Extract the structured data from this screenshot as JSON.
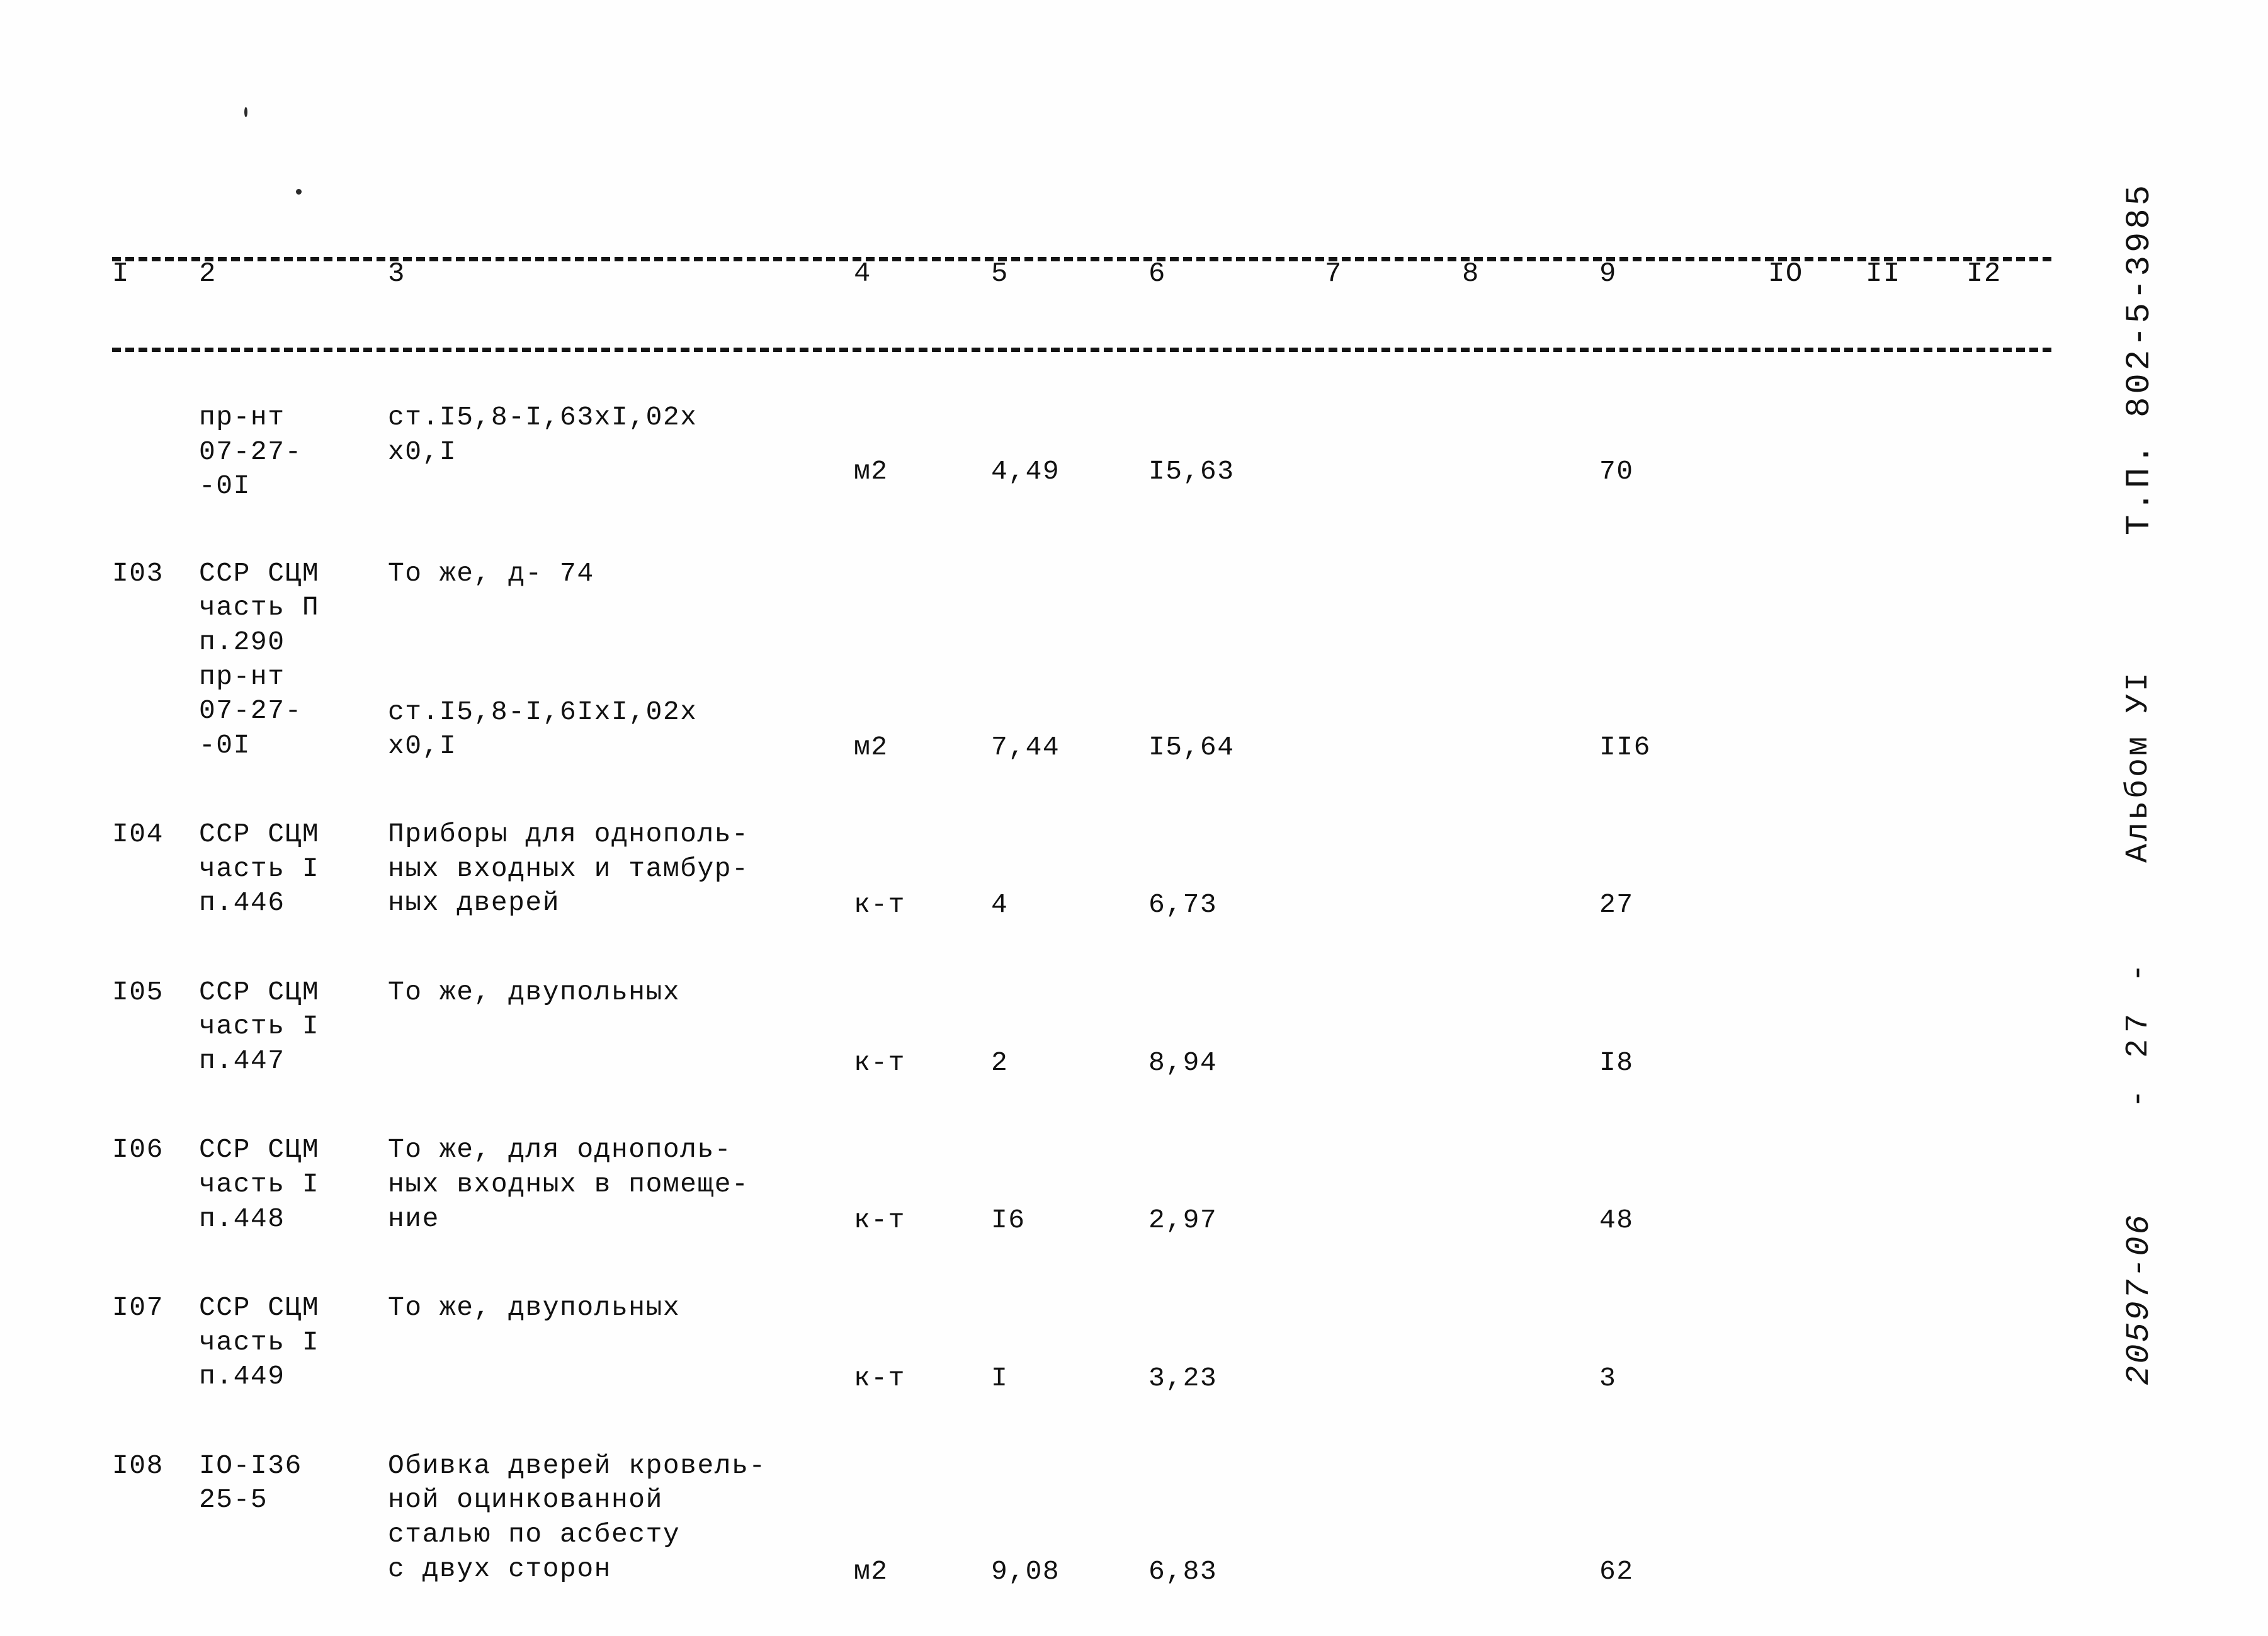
{
  "document": {
    "type": "estimate-table-sheet",
    "column_numbers": [
      "I",
      "2",
      "3",
      "4",
      "5",
      "6",
      "7",
      "8",
      "9",
      "IO",
      "II",
      "I2"
    ]
  },
  "margin": {
    "project_code": "Т.П. 802-5-3985",
    "album": "Альбом УI",
    "page": "- 27 -",
    "archive_code": "20597-06"
  },
  "rows": [
    {
      "num": "",
      "source": "пр-нт\n07-27-\n-0I",
      "description": "ст.I5,8-I,63xI,02x\nх0,I",
      "unit": "м2",
      "qty": "4,49",
      "price": "I5,63",
      "c7": "",
      "c8": "",
      "total": "70",
      "c10": "",
      "c11": "",
      "c12": ""
    },
    {
      "num": "I03",
      "source": "ССР СЦМ\nчасть П\nп.290",
      "description": "То же, д- 74",
      "unit": "",
      "qty": "",
      "price": "",
      "c7": "",
      "c8": "",
      "total": "",
      "c10": "",
      "c11": "",
      "c12": ""
    },
    {
      "num": "",
      "source": "пр-нт\n07-27-\n-0I",
      "description": "ст.I5,8-I,6IxI,02x\nх0,I",
      "unit": "м2",
      "qty": "7,44",
      "price": "I5,64",
      "c7": "",
      "c8": "",
      "total": "II6",
      "c10": "",
      "c11": "",
      "c12": ""
    },
    {
      "num": "I04",
      "source": "ССР СЦМ\nчасть I\nп.446",
      "description": "Приборы для однополь-\nных входных и тамбур-\nных дверей",
      "unit": "к-т",
      "qty": "4",
      "price": "6,73",
      "c7": "",
      "c8": "",
      "total": "27",
      "c10": "",
      "c11": "",
      "c12": ""
    },
    {
      "num": "I05",
      "source": "ССР СЦМ\nчасть I\nп.447",
      "description": "То же, двупольных",
      "unit": "к-т",
      "qty": "2",
      "price": "8,94",
      "c7": "",
      "c8": "",
      "total": "I8",
      "c10": "",
      "c11": "",
      "c12": ""
    },
    {
      "num": "I06",
      "source": "ССР СЦМ\nчасть I\nп.448",
      "description": "То же, для однополь-\nных входных в помеще-\nние",
      "unit": "к-т",
      "qty": "I6",
      "price": "2,97",
      "c7": "",
      "c8": "",
      "total": "48",
      "c10": "",
      "c11": "",
      "c12": ""
    },
    {
      "num": "I07",
      "source": "ССР СЦМ\nчасть I\nп.449",
      "description": "То же, двупольных",
      "unit": "к-т",
      "qty": "I",
      "price": "3,23",
      "c7": "",
      "c8": "",
      "total": "3",
      "c10": "",
      "c11": "",
      "c12": ""
    },
    {
      "num": "I08",
      "source": "IO-I36\n25-5",
      "description": "Обивка дверей кровель-\nной оцинкованной\nсталью по асбесту\nс двух сторон",
      "unit": "м2",
      "qty": "9,08",
      "price": "6,83",
      "c7": "",
      "c8": "",
      "total": "62",
      "c10": "",
      "c11": "",
      "c12": ""
    }
  ]
}
